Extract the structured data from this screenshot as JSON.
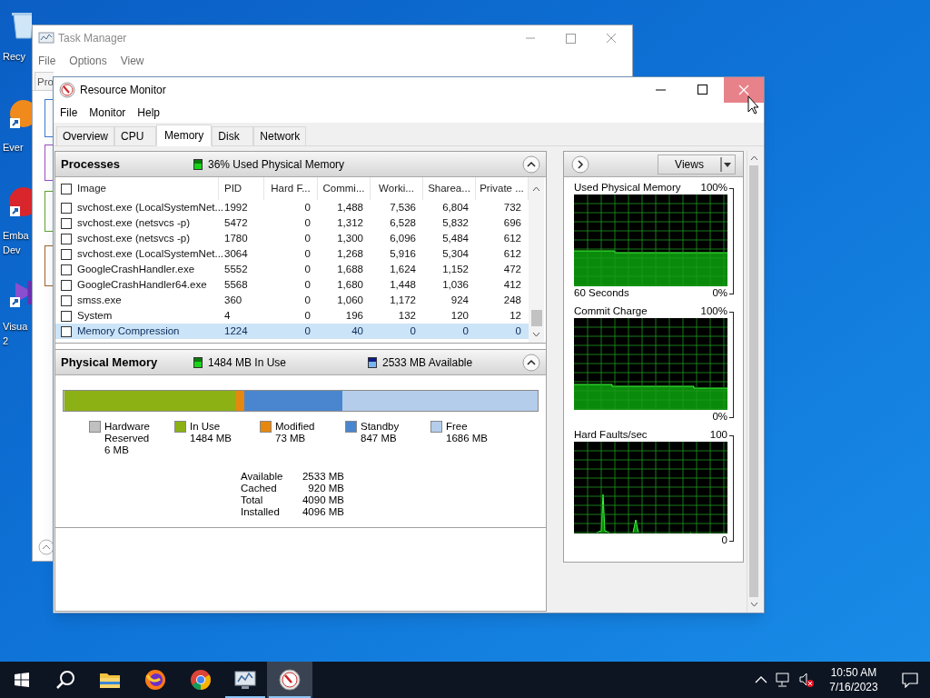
{
  "desktop": {
    "icons": [
      {
        "kind": "recycle",
        "lines": [
          "Recy"
        ]
      },
      {
        "kind": "orange",
        "lines": [
          "Ever"
        ]
      },
      {
        "kind": "red",
        "lines": [
          "Emba",
          "Dev"
        ]
      },
      {
        "kind": "purple",
        "lines": [
          "Visua",
          "2"
        ]
      }
    ]
  },
  "task_manager": {
    "title": "Task Manager",
    "menu": [
      "File",
      "Options",
      "View"
    ],
    "tab": "Pro"
  },
  "resource_monitor": {
    "title": "Resource Monitor",
    "menu": [
      "File",
      "Monitor",
      "Help"
    ],
    "tabs": [
      {
        "label": "Overview",
        "selected": false
      },
      {
        "label": "CPU",
        "selected": false
      },
      {
        "label": "Memory",
        "selected": true
      },
      {
        "label": "Disk",
        "selected": false
      },
      {
        "label": "Network",
        "selected": false
      }
    ],
    "processes": {
      "title": "Processes",
      "status": "36% Used Physical Memory",
      "all_checked": false,
      "columns": [
        "Image",
        "PID",
        "Hard F...",
        "Commi...",
        "Worki...",
        "Sharea...",
        "Private ..."
      ],
      "rows": [
        {
          "cells": [
            "svchost.exe (LocalSystemNet...",
            "1992",
            "0",
            "1,488",
            "7,536",
            "6,804",
            "732"
          ],
          "checked": false,
          "selected": false
        },
        {
          "cells": [
            "svchost.exe (netsvcs -p)",
            "5472",
            "0",
            "1,312",
            "6,528",
            "5,832",
            "696"
          ],
          "checked": false,
          "selected": false
        },
        {
          "cells": [
            "svchost.exe (netsvcs -p)",
            "1780",
            "0",
            "1,300",
            "6,096",
            "5,484",
            "612"
          ],
          "checked": false,
          "selected": false
        },
        {
          "cells": [
            "svchost.exe (LocalSystemNet...",
            "3064",
            "0",
            "1,268",
            "5,916",
            "5,304",
            "612"
          ],
          "checked": false,
          "selected": false
        },
        {
          "cells": [
            "GoogleCrashHandler.exe",
            "5552",
            "0",
            "1,688",
            "1,624",
            "1,152",
            "472"
          ],
          "checked": false,
          "selected": false
        },
        {
          "cells": [
            "GoogleCrashHandler64.exe",
            "5568",
            "0",
            "1,680",
            "1,448",
            "1,036",
            "412"
          ],
          "checked": false,
          "selected": false
        },
        {
          "cells": [
            "smss.exe",
            "360",
            "0",
            "1,060",
            "1,172",
            "924",
            "248"
          ],
          "checked": false,
          "selected": false
        },
        {
          "cells": [
            "System",
            "4",
            "0",
            "196",
            "132",
            "120",
            "12"
          ],
          "checked": false,
          "selected": false
        },
        {
          "cells": [
            "Memory Compression",
            "1224",
            "0",
            "40",
            "0",
            "0",
            "0"
          ],
          "checked": false,
          "selected": true
        }
      ]
    },
    "physical_memory": {
      "title": "Physical Memory",
      "in_use": "1484 MB In Use",
      "available": "2533 MB Available",
      "segments": [
        {
          "label": "Hardware Reserved",
          "value": "6 MB",
          "color": "#c0c0c0"
        },
        {
          "label": "In Use",
          "value": "1484 MB",
          "color": "#8cb114"
        },
        {
          "label": "Modified",
          "value": "73 MB",
          "color": "#e8870e"
        },
        {
          "label": "Standby",
          "value": "847 MB",
          "color": "#4a86d0"
        },
        {
          "label": "Free",
          "value": "1686 MB",
          "color": "#b4cdeb"
        }
      ],
      "summary": [
        {
          "label": "Available",
          "value": "2533 MB"
        },
        {
          "label": "Cached",
          "value": "920 MB"
        },
        {
          "label": "Total",
          "value": "4090 MB"
        },
        {
          "label": "Installed",
          "value": "4096 MB"
        }
      ]
    },
    "side_panel": {
      "views_button": "Views",
      "graphs": [
        {
          "title": "Used Physical Memory",
          "max": "100%",
          "caption": "60 Seconds",
          "min": "0%",
          "kind": "area"
        },
        {
          "title": "Commit Charge",
          "max": "100%",
          "min": "0%",
          "kind": "area_low"
        },
        {
          "title": "Hard Faults/sec",
          "max": "100",
          "min": "0",
          "kind": "spikes"
        }
      ]
    }
  },
  "taskbar": {
    "apps": [
      {
        "kind": "start",
        "running": false,
        "active": false
      },
      {
        "kind": "search",
        "running": false,
        "active": false
      },
      {
        "kind": "folder",
        "running": false,
        "active": false
      },
      {
        "kind": "firefox",
        "running": false,
        "active": false
      },
      {
        "kind": "chrome",
        "running": false,
        "active": false
      },
      {
        "kind": "taskmgr",
        "running": true,
        "active": false
      },
      {
        "kind": "resmon",
        "running": true,
        "active": true
      }
    ],
    "clock": {
      "time": "10:50 AM",
      "date": "7/16/2023"
    }
  }
}
